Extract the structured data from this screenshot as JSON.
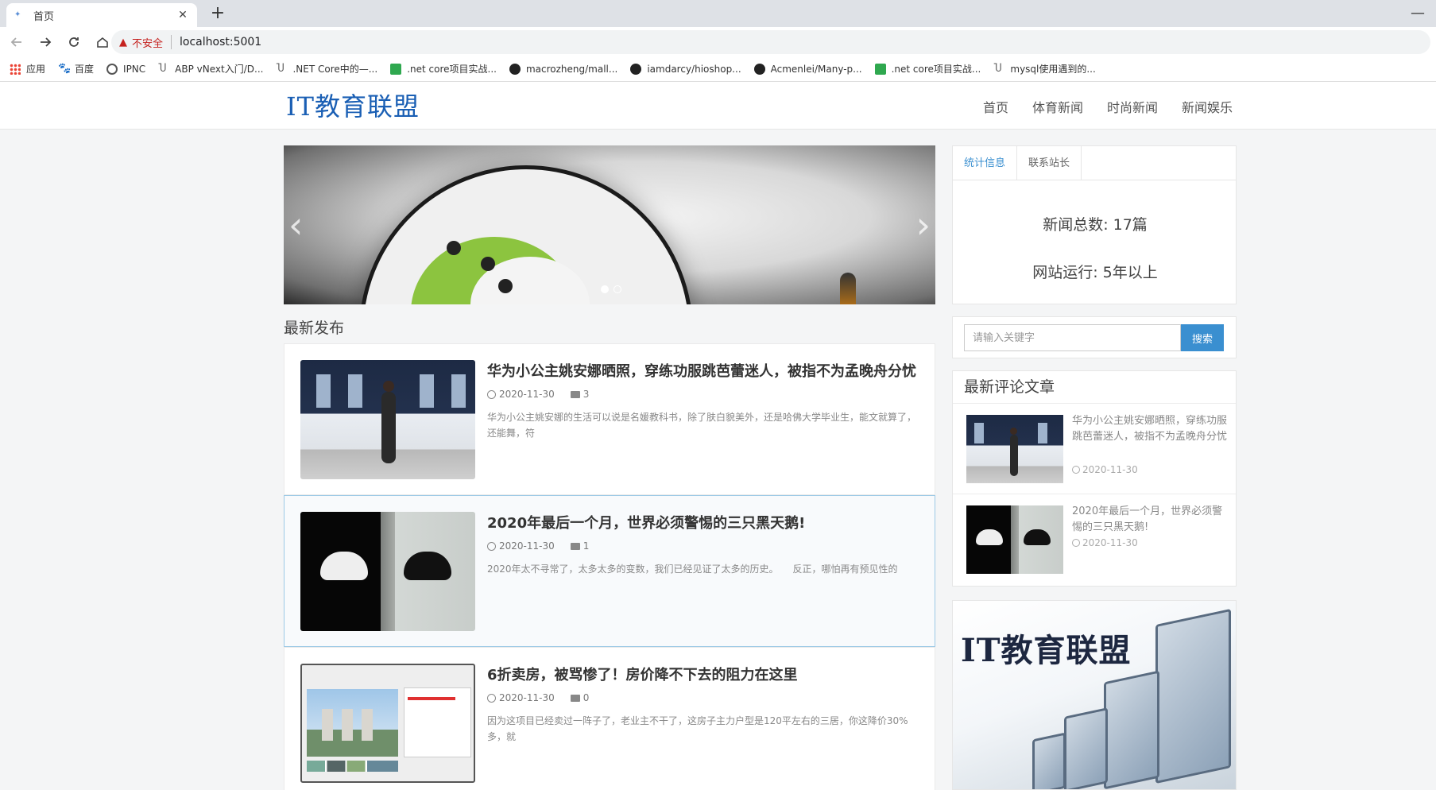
{
  "browser": {
    "tab_title": "首页",
    "tab_close": "✕",
    "new_tab": "+",
    "security_label": "不安全",
    "url": "localhost:5001",
    "bookmarks": [
      {
        "label": "应用",
        "icon": "apps-grid-icon"
      },
      {
        "label": "百度",
        "icon": "baidu-paw-icon"
      },
      {
        "label": "IPNC",
        "icon": "globe-icon"
      },
      {
        "label": "ABP vNext入门/D...",
        "icon": "abp-icon"
      },
      {
        "label": ".NET Core中的—...",
        "icon": "abp-icon"
      },
      {
        "label": ".net core项目实战...",
        "icon": "bookmark-green-icon"
      },
      {
        "label": "macrozheng/mall...",
        "icon": "github-icon"
      },
      {
        "label": "iamdarcy/hioshop...",
        "icon": "github-icon"
      },
      {
        "label": "Acmenlei/Many-p...",
        "icon": "github-icon"
      },
      {
        "label": ".net core项目实战...",
        "icon": "bookmark-green-icon"
      },
      {
        "label": "mysql使用遇到的...",
        "icon": "abp-icon"
      }
    ]
  },
  "site": {
    "logo": "IT教育联盟",
    "nav": [
      "首页",
      "体育新闻",
      "时尚新闻",
      "新闻娱乐"
    ]
  },
  "carousel": {
    "prev": "‹",
    "next": "›",
    "slide_count": 2,
    "active_slide": 1
  },
  "latest": {
    "title": "最新发布",
    "articles": [
      {
        "title": "华为小公主姚安娜晒照，穿练功服跳芭蕾迷人，被指不为孟晚舟分忧",
        "date": "2020-11-30",
        "comments": "3",
        "summary": "华为小公主姚安娜的生活可以说是名媛教科书，除了肤白貌美外，还是哈佛大学毕业生，能文就算了，还能舞，符"
      },
      {
        "title": "2020年最后一个月，世界必须警惕的三只黑天鹅!",
        "date": "2020-11-30",
        "comments": "1",
        "summary": "2020年太不寻常了，太多太多的变数，我们已经见证了太多的历史。　　反正，哪怕再有预见性的"
      },
      {
        "title": "6折卖房，被骂惨了！房价降不下去的阻力在这里",
        "date": "2020-11-30",
        "comments": "0",
        "summary": "因为这项目已经卖过一阵子了，老业主不干了，这房子主力户型是120平左右的三居，你这降价30%多，就"
      }
    ]
  },
  "sidebar": {
    "tabs": [
      "统计信息",
      "联系站长"
    ],
    "stats": {
      "total_news": "新闻总数: 17篇",
      "uptime": "网站运行: 5年以上"
    },
    "search": {
      "placeholder": "请输入关键字",
      "button": "搜索"
    },
    "recent_title": "最新评论文章",
    "recent": [
      {
        "title": "华为小公主姚安娜晒照，穿练功服跳芭蕾迷人，被指不为孟晚舟分忧",
        "date": "2020-11-30"
      },
      {
        "title": "2020年最后一个月，世界必须警惕的三只黑天鹅!",
        "date": "2020-11-30"
      }
    ],
    "ad_text": "IT教育联盟"
  },
  "colors": {
    "accent": "#3a8fd0",
    "logo": "#1a5fb4",
    "security_warning": "#c5221f"
  }
}
